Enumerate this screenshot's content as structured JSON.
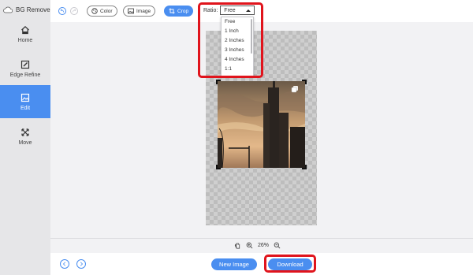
{
  "app": {
    "title": "BG Remover"
  },
  "sidebar": {
    "items": [
      {
        "label": "Home",
        "icon": "home-icon",
        "active": false
      },
      {
        "label": "Edge Refine",
        "icon": "edit-pen-icon",
        "active": false
      },
      {
        "label": "Edit",
        "icon": "image-edit-icon",
        "active": true
      },
      {
        "label": "Move",
        "icon": "move-arrows-icon",
        "active": false
      }
    ]
  },
  "toolbar": {
    "undo_icon": "undo-icon",
    "redo_icon": "redo-icon",
    "color_label": "Color",
    "image_label": "Image",
    "crop_label": "Crop",
    "ratio_label": "Ratio:",
    "ratio_value": "Free"
  },
  "ratio_options": [
    "Free",
    "1 Inch",
    "2 Inches",
    "3 Inches",
    "4 Inches",
    "1:1"
  ],
  "zoom": {
    "value": "26%"
  },
  "bottom": {
    "new_image_label": "New Image",
    "download_label": "Download"
  },
  "colors": {
    "accent": "#4a8ef0",
    "highlight": "#e0141c",
    "sidebar_bg": "#e6e6e8"
  }
}
